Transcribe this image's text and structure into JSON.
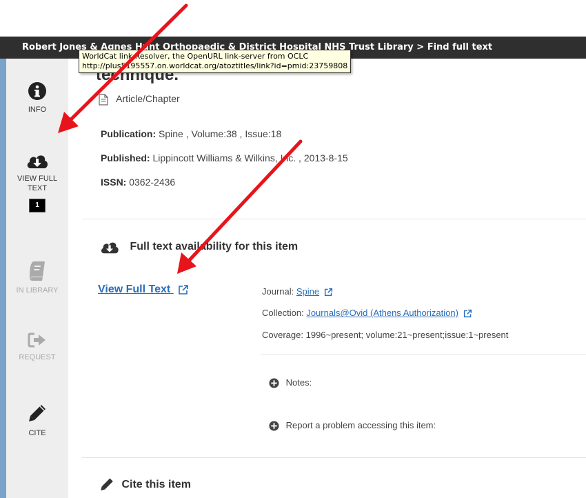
{
  "header": {
    "title": "Robert Jones & Agnes Hunt Orthopaedic & District Hospital NHS Trust Library >  Find full text"
  },
  "tooltip": {
    "line1": "WorldCat link Resolver, the OpenURL link-server from OCLC",
    "line2": "http://plus5195557.on.worldcat.org/atoztitles/link?id=pmid:23759808"
  },
  "sidebar": {
    "items": [
      {
        "label": "INFO",
        "icon": "info-icon"
      },
      {
        "label": "VIEW FULL TEXT",
        "icon": "cloud-download-icon",
        "badge": "1"
      },
      {
        "label": "IN LIBRARY",
        "icon": "book-icon"
      },
      {
        "label": "REQUEST",
        "icon": "request-icon"
      },
      {
        "label": "CITE",
        "icon": "pencil-icon"
      }
    ]
  },
  "record": {
    "title_fragment": "technique.",
    "type": "Article/Chapter",
    "publication_label": "Publication:",
    "publication_value": "Spine , Volume:38 , Issue:18",
    "published_label": "Published:",
    "published_value": "Lippincott Williams & Wilkins, Inc. , 2013-8-15",
    "issn_label": "ISSN:",
    "issn_value": "0362-2436"
  },
  "fulltext": {
    "heading": "Full text availability for this item",
    "link_label": "View Full Text",
    "journal_label": "Journal:",
    "journal_value": "Spine",
    "collection_label": "Collection:",
    "collection_value": "Journals@Ovid (Athens Authorization)",
    "coverage_label": "Coverage:",
    "coverage_value": "1996~present; volume:21~present;issue:1~present",
    "notes_label": "Notes:",
    "report_label": "Report a problem accessing this item:"
  },
  "cite": {
    "heading": "Cite this item"
  },
  "colors": {
    "link": "#2a6ebb",
    "arrow": "#e8141b",
    "sidebar_bg": "#eeeeee",
    "header_bg": "#2f2f2f"
  }
}
